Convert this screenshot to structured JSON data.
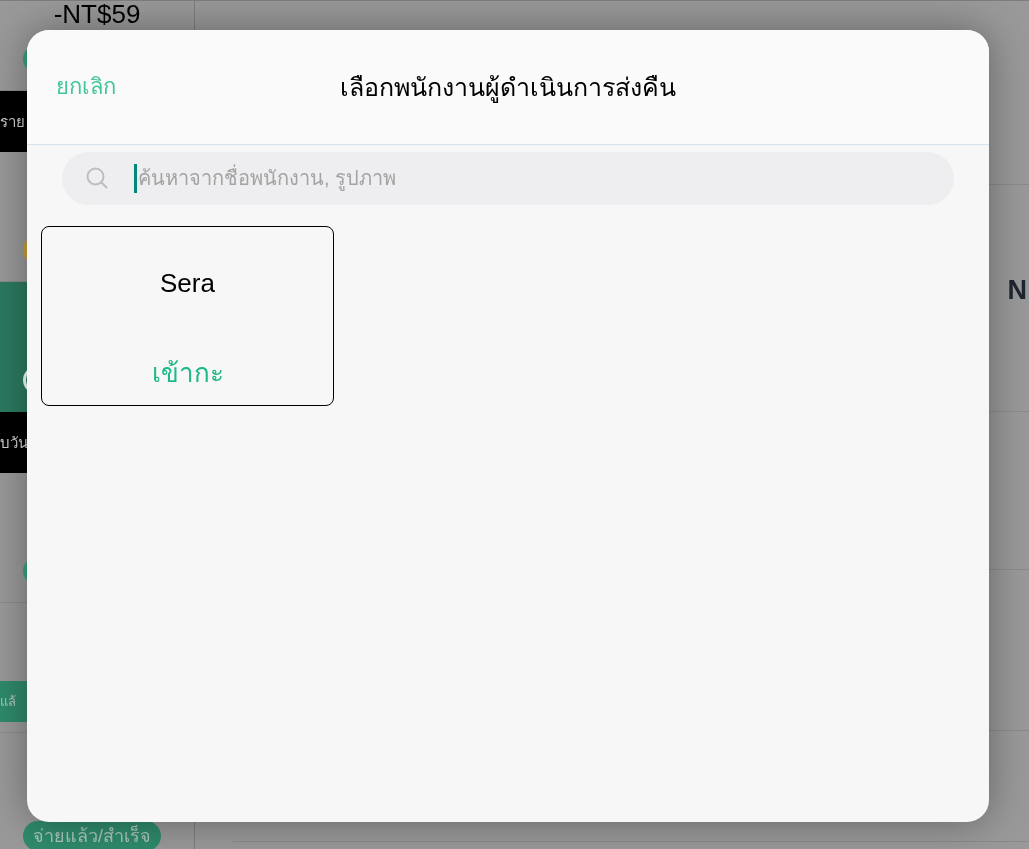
{
  "background": {
    "amount": "-NT$59",
    "rows": [
      {
        "kind": "plain",
        "dot": {
          "color": "#2f8a6c"
        }
      },
      {
        "kind": "banner",
        "text": "ราย"
      },
      {
        "kind": "plain",
        "dot": {
          "color": "#a8872b"
        }
      },
      {
        "kind": "highlighted",
        "dot": {
          "color": "#cfd8d4"
        }
      },
      {
        "kind": "banner",
        "text": "บวัน"
      },
      {
        "kind": "plain",
        "dot": {
          "color": "#2f8a6c"
        }
      },
      {
        "kind": "badge",
        "text": "แล้"
      },
      {
        "kind": "badge",
        "text": "จ่ายแล้ว/สำเร็จ"
      }
    ],
    "right_text": "N"
  },
  "dialog": {
    "cancel": "ยกเลิก",
    "title": "เลือกพนักงานผู้ดำเนินการส่งคืน",
    "search": {
      "placeholder": "ค้นหาจากชื่อพนักงาน, รูปภาพ"
    },
    "employees": [
      {
        "name": "Sera",
        "status": "เข้ากะ"
      }
    ]
  }
}
